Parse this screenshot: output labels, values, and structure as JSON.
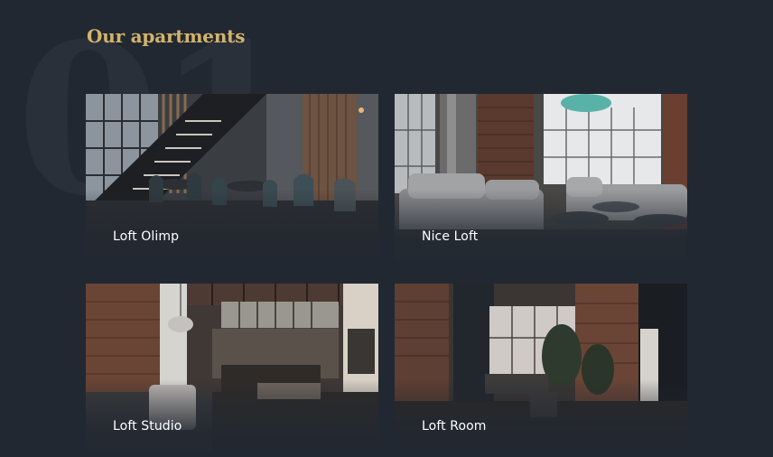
{
  "section": {
    "title": "Our apartments"
  },
  "apartments": [
    {
      "name": "Loft Olimp",
      "photo_icon": "loft-staircase-photo"
    },
    {
      "name": "Nice Loft",
      "photo_icon": "loft-living-room-photo"
    },
    {
      "name": "Loft Studio",
      "photo_icon": "loft-studio-photo"
    },
    {
      "name": "Loft Room",
      "photo_icon": "loft-room-photo"
    }
  ],
  "colors": {
    "background": "#222831",
    "title": "#d3b46c",
    "label": "#ffffff"
  }
}
